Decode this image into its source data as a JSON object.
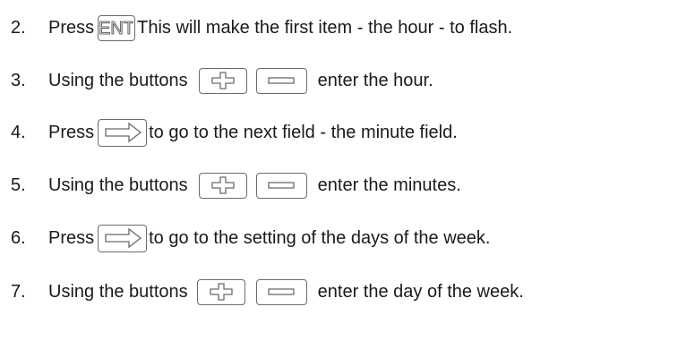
{
  "steps": [
    {
      "number": "2.",
      "before": "Press",
      "key": "ENT",
      "after": "This will make the first item - the hour - to flash."
    },
    {
      "number": "3.",
      "before": "Using the buttons",
      "after": "enter the hour."
    },
    {
      "number": "4.",
      "before": "Press",
      "after": "to go to the next field - the minute field."
    },
    {
      "number": "5.",
      "before": "Using the buttons",
      "after": "enter the minutes."
    },
    {
      "number": "6.",
      "before": "Press",
      "after": "to go to the setting of the days of the week."
    },
    {
      "number": "7.",
      "before": "Using the buttons",
      "after": "enter the day of the week."
    }
  ],
  "icons": {
    "ent": "ent-key-icon",
    "plus": "plus-key-icon",
    "minus": "minus-key-icon",
    "next": "next-arrow-key-icon"
  },
  "colors": {
    "text": "#1a1a1a",
    "key_border": "#6b6b6b"
  }
}
